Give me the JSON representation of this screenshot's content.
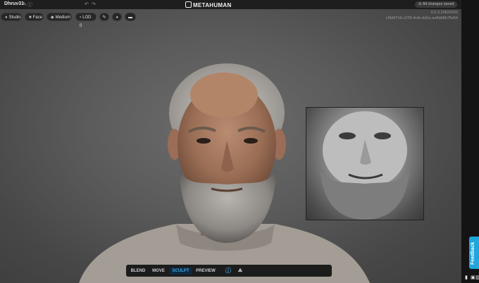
{
  "header": {
    "project_name": "Dhruv31",
    "logo_text": "METAHUMAN",
    "save_status": "All changes saved",
    "version": "0.5.3.20622420",
    "build_hash": "c9b6f716-c278-4cdc-bd1c-ae8dd6b75e54"
  },
  "viewport_toolbar": {
    "lighting": "Studio",
    "camera": "Face",
    "quality": "Medium",
    "lod": "LOD 0"
  },
  "modes": [
    "BLEND",
    "MOVE",
    "SCULPT",
    "PREVIEW"
  ],
  "active_mode": "SCULPT",
  "feedback_label": "Feedback",
  "colors": {
    "accent": "#1fa6dc",
    "active_mode_text": "#3ea5e6",
    "background": "#5b5b5b"
  }
}
